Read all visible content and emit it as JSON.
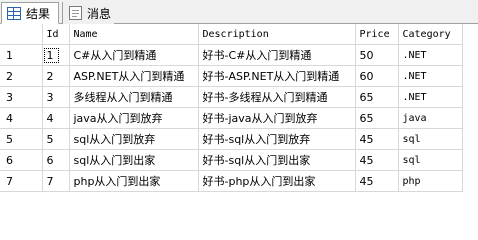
{
  "tabs": [
    {
      "label": "结果",
      "icon": "grid-icon",
      "active": true
    },
    {
      "label": "消息",
      "icon": "message-icon",
      "active": false
    }
  ],
  "columns": [
    "",
    "Id",
    "Name",
    "Description",
    "Price",
    "Category"
  ],
  "rows": [
    {
      "rownum": "1",
      "id": "1",
      "name": "C#从入门到精通",
      "description": "好书-C#从入门到精通",
      "price": "50",
      "category": ".NET"
    },
    {
      "rownum": "2",
      "id": "2",
      "name": "ASP.NET从入门到精通",
      "description": "好书-ASP.NET从入门到精通",
      "price": "60",
      "category": ".NET"
    },
    {
      "rownum": "3",
      "id": "3",
      "name": "多线程从入门到精通",
      "description": "好书-多线程从入门到精通",
      "price": "65",
      "category": ".NET"
    },
    {
      "rownum": "4",
      "id": "4",
      "name": "java从入门到放弃",
      "description": "好书-java从入门到放弃",
      "price": "65",
      "category": "java"
    },
    {
      "rownum": "5",
      "id": "5",
      "name": "sql从入门到放弃",
      "description": "好书-sql从入门到放弃",
      "price": "45",
      "category": "sql"
    },
    {
      "rownum": "6",
      "id": "6",
      "name": "sql从入门到出家",
      "description": "好书-sql从入门到出家",
      "price": "45",
      "category": "sql"
    },
    {
      "rownum": "7",
      "id": "7",
      "name": "php从入门到出家",
      "description": "好书-php从入门到出家",
      "price": "45",
      "category": "php"
    }
  ]
}
